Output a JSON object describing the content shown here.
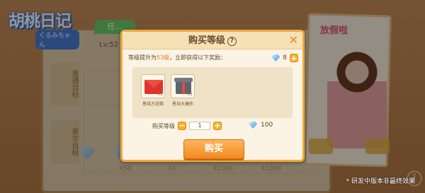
{
  "game": {
    "logo_main": "胡桃日记",
    "logo_sub": "くるみちゃん"
  },
  "background": {
    "tab_label": "任...",
    "level_text": "Lv:52",
    "side_labels": [
      "普通目标",
      "豪华目标"
    ],
    "multipliers": [
      "X50",
      "X3",
      "X1000",
      "X1000"
    ],
    "right_panel_title": "放假啦"
  },
  "modal": {
    "title": "购买等级",
    "description_prefix": "等级提升为",
    "description_level": "53级",
    "description_suffix": "，立即获得以下奖励：",
    "balance": {
      "icon": "diamond-icon",
      "value": "8"
    },
    "rewards": [
      {
        "icon": "red-envelope-icon",
        "qty": "X1",
        "name": "恩培万花筒"
      },
      {
        "icon": "gift-box-icon",
        "qty": "X1",
        "name": "恩培大爆炸"
      }
    ],
    "quantity": {
      "label": "购买等级",
      "minus": "−",
      "value": "1",
      "plus": "+"
    },
    "cost": {
      "icon": "diamond-icon",
      "value": "100"
    },
    "buy_label": "购买"
  },
  "footer_note": "* 研发中版本非最终效果",
  "colors": {
    "accent_orange": "#f28a20",
    "modal_bg": "#fbf3e4",
    "highlight": "#e57a1d"
  }
}
